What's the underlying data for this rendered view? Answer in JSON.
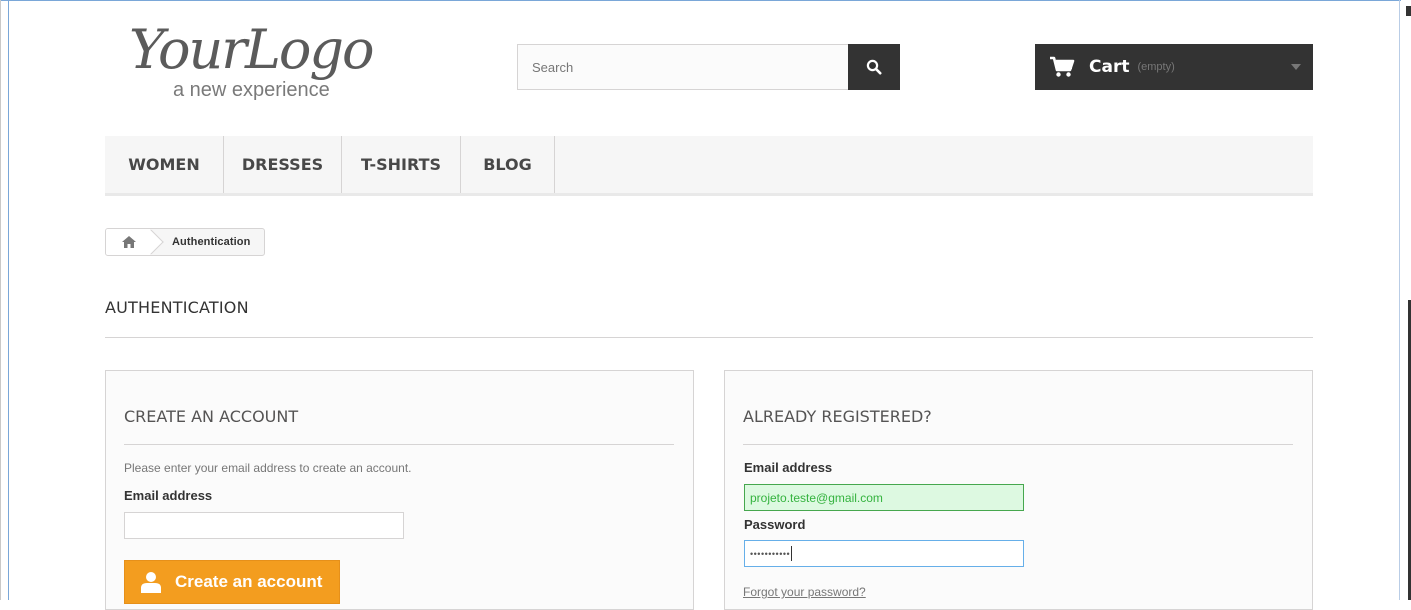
{
  "logo": {
    "main_text": "YourLogo",
    "tagline": "a new experience"
  },
  "search": {
    "placeholder": "Search"
  },
  "cart": {
    "label": "Cart",
    "status": "(empty)"
  },
  "nav": {
    "items": [
      {
        "label": "Women"
      },
      {
        "label": "Dresses"
      },
      {
        "label": "T-shirts"
      },
      {
        "label": "Blog"
      }
    ]
  },
  "breadcrumb": {
    "current": "Authentication"
  },
  "page": {
    "heading": "AUTHENTICATION"
  },
  "create_account": {
    "title": "CREATE AN ACCOUNT",
    "instruction": "Please enter your email address to create an account.",
    "email_label": "Email address",
    "email_value": "",
    "button_label": "Create an account"
  },
  "login": {
    "title": "ALREADY REGISTERED?",
    "email_label": "Email address",
    "email_value": "projeto.teste@gmail.com",
    "password_label": "Password",
    "password_mask": "•••••••••••",
    "forgot_label": "Forgot your password?"
  },
  "colors": {
    "accent_orange": "#f39d1f",
    "dark": "#333333",
    "valid_bg": "#ddf9e1",
    "valid_text": "#35b33f"
  },
  "icons": {
    "search": "search-icon",
    "cart": "cart-icon",
    "home": "home-icon",
    "user": "user-icon",
    "caret": "chevron-down-icon"
  }
}
